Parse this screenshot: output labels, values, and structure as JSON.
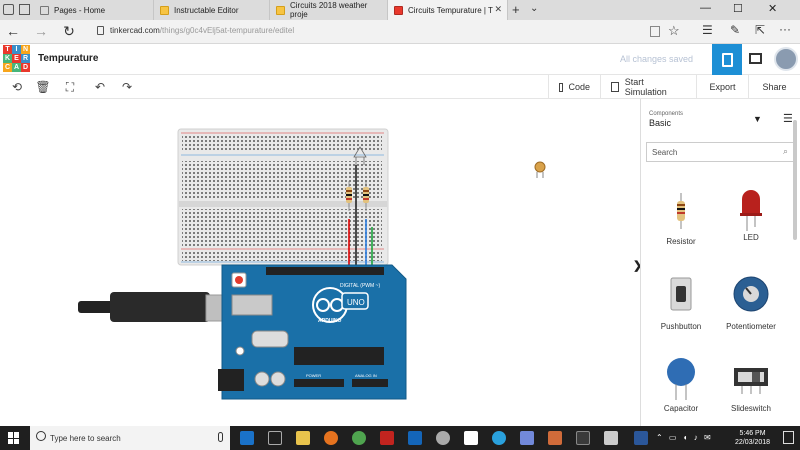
{
  "browser": {
    "tabs": [
      {
        "label": "Pages - Home"
      },
      {
        "label": "Instructable Editor"
      },
      {
        "label": "Circuits 2018 weather proje"
      },
      {
        "label": "Circuits Tempurature | T"
      }
    ],
    "url_host": "tinkercad.com",
    "url_path": "/things/g0c4vElj5at-tempurature/editel"
  },
  "app": {
    "logo_letters": [
      "T",
      "I",
      "N",
      "K",
      "E",
      "R",
      "C",
      "A",
      "D"
    ],
    "logo_colors": [
      "#e9382c",
      "#3a8fc9",
      "#f7a51c",
      "#48b57a",
      "#e9382c",
      "#3a8fc9",
      "#f7a51c",
      "#48b57a",
      "#e9382c"
    ],
    "title": "Tempurature",
    "save_status": "All changes saved",
    "accent": "#1d8fd5"
  },
  "toolbar": {
    "code_label": "Code",
    "start_sim_label": "Start Simulation",
    "export_label": "Export",
    "share_label": "Share"
  },
  "board": {
    "brand": "ARDUINO",
    "model": "UNO",
    "digital_label": "DIGITAL (PWM ~)",
    "power_label": "POWER",
    "analog_label": "ANALOG IN"
  },
  "panel": {
    "components_label": "Components",
    "category": "Basic",
    "search_placeholder": "Search",
    "items": [
      {
        "label": "Resistor",
        "icon": "resistor-icon"
      },
      {
        "label": "LED",
        "icon": "led-icon"
      },
      {
        "label": "Pushbutton",
        "icon": "pushbutton-icon"
      },
      {
        "label": "Potentiometer",
        "icon": "potentiometer-icon"
      },
      {
        "label": "Capacitor",
        "icon": "capacitor-icon"
      },
      {
        "label": "Slideswitch",
        "icon": "slideswitch-icon"
      }
    ]
  },
  "taskbar": {
    "search_placeholder": "Type here to search",
    "time": "5:46 PM",
    "date": "22/03/2018"
  }
}
